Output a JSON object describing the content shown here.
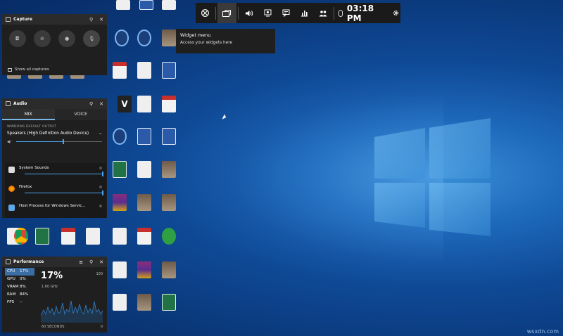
{
  "topbar": {
    "time": "03:18 PM",
    "buttons": [
      "xbox-icon",
      "widget-menu-icon",
      "audio-icon",
      "capture-icon",
      "chat-icon",
      "performance-icon",
      "party-icon",
      "mouse-icon",
      "settings-icon"
    ]
  },
  "tooltip": {
    "title": "Widget menu",
    "subtitle": "Access your widgets here"
  },
  "capture": {
    "title": "Capture",
    "show_all": "Show all captures"
  },
  "audio": {
    "title": "Audio",
    "tab_mix": "MIX",
    "tab_voice": "VOICE",
    "section": "WINDOWS DEFAULT OUTPUT",
    "device": "Speakers (High Definition Audio Device)",
    "master_level": 0.55,
    "apps": [
      {
        "name": "System Sounds",
        "level": 1.0
      },
      {
        "name": "Firefox",
        "level": 1.0
      },
      {
        "name": "Host Process for Windows Servic..."
      }
    ]
  },
  "performance": {
    "title": "Performance",
    "metrics": [
      {
        "key": "CPU",
        "value": "17%"
      },
      {
        "key": "GPU",
        "value": "0%"
      },
      {
        "key": "VRAM",
        "value": "8%"
      },
      {
        "key": "RAM",
        "value": "84%"
      },
      {
        "key": "FPS",
        "value": "--"
      }
    ],
    "big_value": "17%",
    "clock": "1.60 GHz",
    "max": "100",
    "min": "0",
    "window": "60 SECONDS"
  },
  "watermark": "wsxdn.com"
}
